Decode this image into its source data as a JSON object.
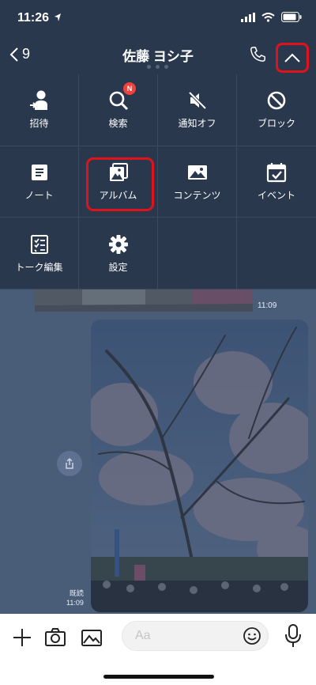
{
  "status_bar": {
    "time": "11:26"
  },
  "header": {
    "back_count": "9",
    "title": "佐藤 ヨシ子"
  },
  "menu": {
    "items": [
      {
        "label": "招待",
        "icon": "invite-icon"
      },
      {
        "label": "検索",
        "icon": "search-icon",
        "badge": "N"
      },
      {
        "label": "通知オフ",
        "icon": "mute-icon"
      },
      {
        "label": "ブロック",
        "icon": "block-icon"
      },
      {
        "label": "ノート",
        "icon": "note-icon"
      },
      {
        "label": "アルバム",
        "icon": "album-icon"
      },
      {
        "label": "コンテンツ",
        "icon": "contents-icon"
      },
      {
        "label": "イベント",
        "icon": "event-icon"
      },
      {
        "label": "トーク編集",
        "icon": "edit-chat-icon"
      },
      {
        "label": "設定",
        "icon": "settings-icon"
      }
    ]
  },
  "chat": {
    "prev_message_time": "11:09",
    "photo_read_label": "既読",
    "photo_time": "11:09"
  },
  "input_bar": {
    "placeholder": "Aa"
  },
  "colors": {
    "header_bg": "#2a384e",
    "highlight": "#e0121b",
    "badge": "#f1413c",
    "chat_bg": "#7b91b1"
  }
}
